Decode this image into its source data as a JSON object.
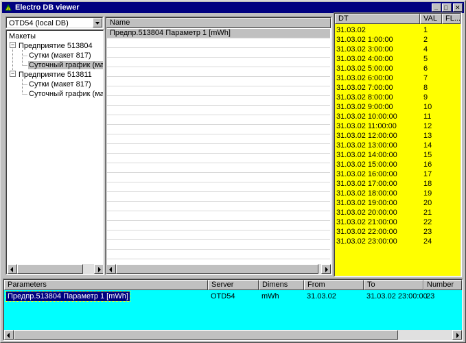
{
  "window": {
    "title": "Electro DB viewer",
    "controls": {
      "minimize": "_",
      "maximize": "□",
      "close": "✕"
    }
  },
  "database_select": {
    "value": "OTD54 (local DB)"
  },
  "tree": {
    "root": "Макеты",
    "nodes": [
      {
        "label": "Предприятие 513804",
        "expanded": "−",
        "children": [
          "Сутки (макет 817)",
          "Суточный график (ма"
        ]
      },
      {
        "label": "Предприятие 513811",
        "expanded": "−",
        "children": [
          "Сутки (макет 817)",
          "Суточный график (ма"
        ]
      }
    ]
  },
  "names": {
    "header": "Name",
    "rows": [
      "Предпр.513804 Параметр 1 [mWh]"
    ]
  },
  "values": {
    "headers": {
      "dt": "DT",
      "val": "VAL",
      "flags": "FL..."
    },
    "rows": [
      {
        "dt": "31.03.02",
        "val": "1"
      },
      {
        "dt": "31.03.02 1:00:00",
        "val": "2"
      },
      {
        "dt": "31.03.02 3:00:00",
        "val": "4"
      },
      {
        "dt": "31.03.02 4:00:00",
        "val": "5"
      },
      {
        "dt": "31.03.02 5:00:00",
        "val": "6"
      },
      {
        "dt": "31.03.02 6:00:00",
        "val": "7"
      },
      {
        "dt": "31.03.02 7:00:00",
        "val": "8"
      },
      {
        "dt": "31.03.02 8:00:00",
        "val": "9"
      },
      {
        "dt": "31.03.02 9:00:00",
        "val": "10"
      },
      {
        "dt": "31.03.02 10:00:00",
        "val": "11"
      },
      {
        "dt": "31.03.02 11:00:00",
        "val": "12"
      },
      {
        "dt": "31.03.02 12:00:00",
        "val": "13"
      },
      {
        "dt": "31.03.02 13:00:00",
        "val": "14"
      },
      {
        "dt": "31.03.02 14:00:00",
        "val": "15"
      },
      {
        "dt": "31.03.02 15:00:00",
        "val": "16"
      },
      {
        "dt": "31.03.02 16:00:00",
        "val": "17"
      },
      {
        "dt": "31.03.02 17:00:00",
        "val": "18"
      },
      {
        "dt": "31.03.02 18:00:00",
        "val": "19"
      },
      {
        "dt": "31.03.02 19:00:00",
        "val": "20"
      },
      {
        "dt": "31.03.02 20:00:00",
        "val": "21"
      },
      {
        "dt": "31.03.02 21:00:00",
        "val": "22"
      },
      {
        "dt": "31.03.02 22:00:00",
        "val": "23"
      },
      {
        "dt": "31.03.02 23:00:00",
        "val": "24"
      }
    ]
  },
  "parameters": {
    "headers": {
      "parameters": "Parameters",
      "server": "Server",
      "dimens": "Dimens",
      "from": "From",
      "to": "To",
      "number": "Number"
    },
    "row": {
      "parameter": "Предпр.513804 Параметр 1 [mWh]",
      "server": "OTD54",
      "dimens": "mWh",
      "from": "31.03.02",
      "to": "31.03.02 23:00:00",
      "number": "23"
    }
  },
  "colors": {
    "titlebar": "#000080",
    "values_bg": "#ffff00",
    "parameters_bg": "#00ffff",
    "selection": "#000080"
  }
}
